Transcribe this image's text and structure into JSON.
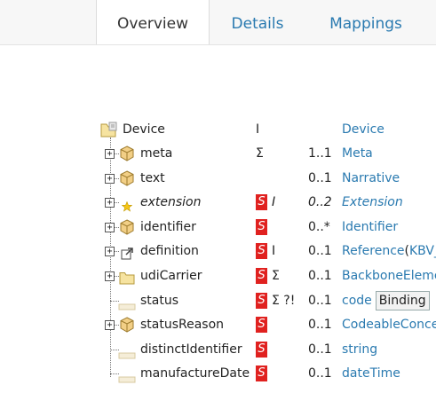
{
  "tabs": [
    {
      "label": "Overview",
      "active": true
    },
    {
      "label": "Details",
      "active": false
    },
    {
      "label": "Mappings",
      "active": false
    }
  ],
  "root": {
    "name": "Device",
    "flags": "I",
    "type": "Device"
  },
  "rows": [
    {
      "name": "meta",
      "icon": "cube-icon",
      "s": false,
      "flags": "Σ",
      "card": "1..1",
      "type": "Meta",
      "italic": false
    },
    {
      "name": "text",
      "icon": "cube-icon",
      "s": false,
      "flags": "",
      "card": "0..1",
      "type": "Narrative",
      "italic": false
    },
    {
      "name": "extension",
      "icon": "star-icon",
      "s": true,
      "flags": "I",
      "card": "0..2",
      "type": "Extension",
      "italic": true
    },
    {
      "name": "identifier",
      "icon": "cube-icon",
      "s": true,
      "flags": "",
      "card": "0..*",
      "type": "Identifier",
      "italic": false
    },
    {
      "name": "definition",
      "icon": "reference-icon",
      "s": true,
      "flags": "I",
      "card": "0..1",
      "type": "Reference",
      "type_suffix_open": "(",
      "type_suffix": "KBV_",
      "italic": false
    },
    {
      "name": "udiCarrier",
      "icon": "folder-icon",
      "s": true,
      "flags": "Σ",
      "card": "0..1",
      "type": "BackboneEleme",
      "italic": false
    },
    {
      "name": "status",
      "icon": "primitive-icon",
      "s": true,
      "flags": "Σ ?!",
      "card": "0..1",
      "type": "code",
      "binding": "Binding",
      "italic": false
    },
    {
      "name": "statusReason",
      "icon": "cube-icon",
      "s": true,
      "flags": "",
      "card": "0..1",
      "type": "CodeableConce",
      "italic": false
    },
    {
      "name": "distinctIdentifier",
      "icon": "primitive-icon",
      "s": true,
      "flags": "",
      "card": "0..1",
      "type": "string",
      "italic": false
    },
    {
      "name": "manufactureDate",
      "icon": "primitive-icon",
      "s": true,
      "flags": "",
      "card": "0..1",
      "type": "dateTime",
      "italic": false
    }
  ],
  "colors": {
    "link": "#2a7ab0",
    "badge": "#e0211f",
    "active_tab_accent": "#f0a020"
  },
  "badge_label": "S"
}
